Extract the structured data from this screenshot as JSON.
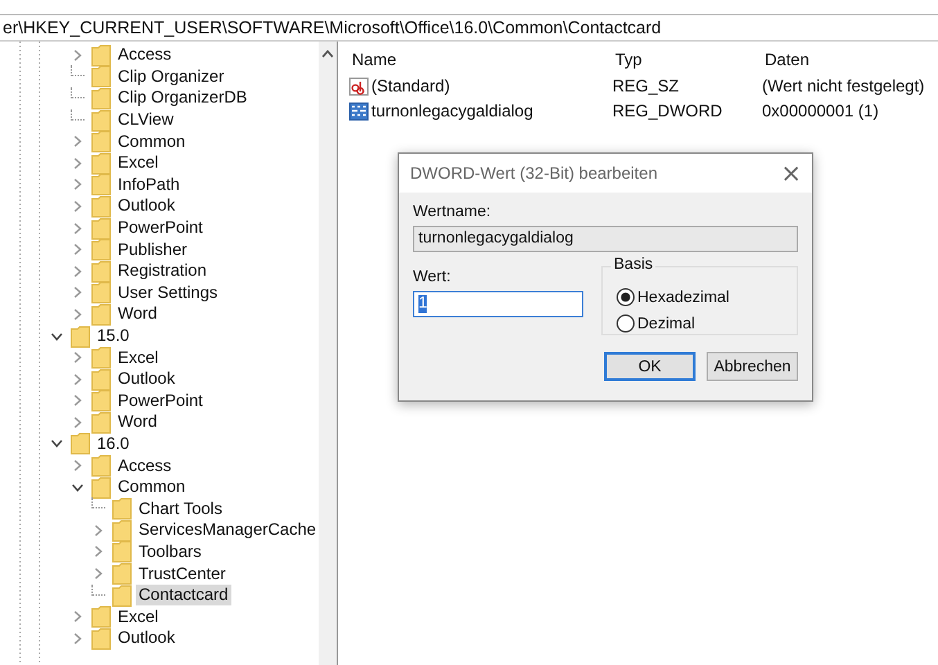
{
  "address_bar": {
    "path": "er\\HKEY_CURRENT_USER\\SOFTWARE\\Microsoft\\Office\\16.0\\Common\\Contactcard"
  },
  "tree": {
    "continued_children": [
      {
        "label": "Access",
        "has_children": true,
        "expanded": false,
        "selected": false
      },
      {
        "label": "Clip Organizer",
        "has_children": false,
        "selected": false
      },
      {
        "label": "Clip OrganizerDB",
        "has_children": false,
        "selected": false
      },
      {
        "label": "CLView",
        "has_children": false,
        "selected": false
      },
      {
        "label": "Common",
        "has_children": true,
        "expanded": false,
        "selected": false
      },
      {
        "label": "Excel",
        "has_children": true,
        "expanded": false,
        "selected": false
      },
      {
        "label": "InfoPath",
        "has_children": true,
        "expanded": false,
        "selected": false
      },
      {
        "label": "Outlook",
        "has_children": true,
        "expanded": false,
        "selected": false
      },
      {
        "label": "PowerPoint",
        "has_children": true,
        "expanded": false,
        "selected": false
      },
      {
        "label": "Publisher",
        "has_children": true,
        "expanded": false,
        "selected": false
      },
      {
        "label": "Registration",
        "has_children": true,
        "expanded": false,
        "selected": false
      },
      {
        "label": "User Settings",
        "has_children": true,
        "expanded": false,
        "selected": false
      },
      {
        "label": "Word",
        "has_children": true,
        "expanded": false,
        "selected": false
      }
    ],
    "items": [
      {
        "label": "15.0",
        "has_children": true,
        "expanded": true,
        "selected": false,
        "children": [
          {
            "label": "Excel",
            "has_children": true,
            "expanded": false,
            "selected": false
          },
          {
            "label": "Outlook",
            "has_children": true,
            "expanded": false,
            "selected": false
          },
          {
            "label": "PowerPoint",
            "has_children": true,
            "expanded": false,
            "selected": false
          },
          {
            "label": "Word",
            "has_children": true,
            "expanded": false,
            "selected": false
          }
        ]
      },
      {
        "label": "16.0",
        "has_children": true,
        "expanded": true,
        "selected": false,
        "children": [
          {
            "label": "Access",
            "has_children": true,
            "expanded": false,
            "selected": false
          },
          {
            "label": "Common",
            "has_children": true,
            "expanded": true,
            "selected": false,
            "children": [
              {
                "label": "Chart Tools",
                "has_children": false,
                "selected": false
              },
              {
                "label": "ServicesManagerCache",
                "has_children": true,
                "expanded": false,
                "selected": false
              },
              {
                "label": "Toolbars",
                "has_children": true,
                "expanded": false,
                "selected": false
              },
              {
                "label": "TrustCenter",
                "has_children": true,
                "expanded": false,
                "selected": false
              },
              {
                "label": "Contactcard",
                "has_children": false,
                "selected": true
              }
            ]
          },
          {
            "label": "Excel",
            "has_children": true,
            "expanded": false,
            "selected": false
          },
          {
            "label": "Outlook",
            "has_children": true,
            "expanded": false,
            "selected": false
          }
        ]
      }
    ]
  },
  "values_list": {
    "columns": [
      "Name",
      "Typ",
      "Daten"
    ],
    "rows": [
      {
        "kind": "string",
        "name": "(Standard)",
        "type": "REG_SZ",
        "data": "(Wert nicht festgelegt)"
      },
      {
        "kind": "binary",
        "name": "turnonlegacygaldialog",
        "type": "REG_DWORD",
        "data": "0x00000001 (1)"
      }
    ]
  },
  "dialog": {
    "title": "DWORD-Wert (32-Bit) bearbeiten",
    "close": "×",
    "name_label": "Wertname:",
    "name_value": "turnonlegacygaldialog",
    "value_label": "Wert:",
    "value": "1",
    "base_group": {
      "title": "Basis",
      "options": [
        {
          "label": "Hexadezimal",
          "selected": true
        },
        {
          "label": "Dezimal",
          "selected": false
        }
      ]
    },
    "buttons": [
      {
        "label": "OK",
        "default": true
      },
      {
        "label": "Abbrechen",
        "default": false
      }
    ]
  }
}
